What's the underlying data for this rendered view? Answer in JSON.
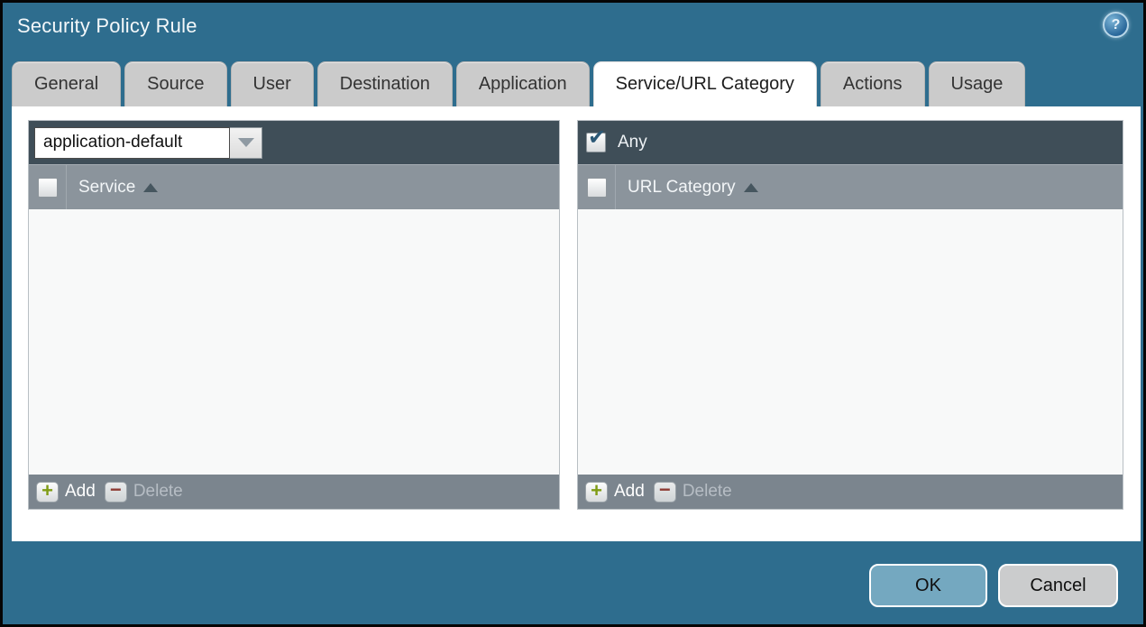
{
  "window": {
    "title": "Security Policy Rule",
    "help_icon": "?"
  },
  "tabs": [
    {
      "label": "General",
      "active": false
    },
    {
      "label": "Source",
      "active": false
    },
    {
      "label": "User",
      "active": false
    },
    {
      "label": "Destination",
      "active": false
    },
    {
      "label": "Application",
      "active": false
    },
    {
      "label": "Service/URL Category",
      "active": true
    },
    {
      "label": "Actions",
      "active": false
    },
    {
      "label": "Usage",
      "active": false
    }
  ],
  "service_panel": {
    "service_select_value": "application-default",
    "select_all_checked": false,
    "column_header": "Service",
    "rows": [],
    "add_label": "Add",
    "delete_label": "Delete",
    "delete_enabled": false
  },
  "url_category_panel": {
    "any_label": "Any",
    "any_checked": true,
    "select_all_checked": false,
    "column_header": "URL Category",
    "rows": [],
    "add_label": "Add",
    "delete_label": "Delete",
    "delete_enabled": false
  },
  "footer": {
    "ok_label": "OK",
    "cancel_label": "Cancel"
  },
  "colors": {
    "titlebar_teal": "#2e6d8e",
    "strip_dark": "#3f4e58",
    "column_header_gray": "#8b949c",
    "footer_bar_gray": "#7b858e",
    "tab_gray": "#cbcbcb",
    "active_tab": "#ffffff",
    "ok_blue": "#74a8c0",
    "cancel_gray": "#cbcccd",
    "checkmark_blue": "#2b5876",
    "add_green": "#7f9c14",
    "delete_red": "#8e3b34"
  }
}
